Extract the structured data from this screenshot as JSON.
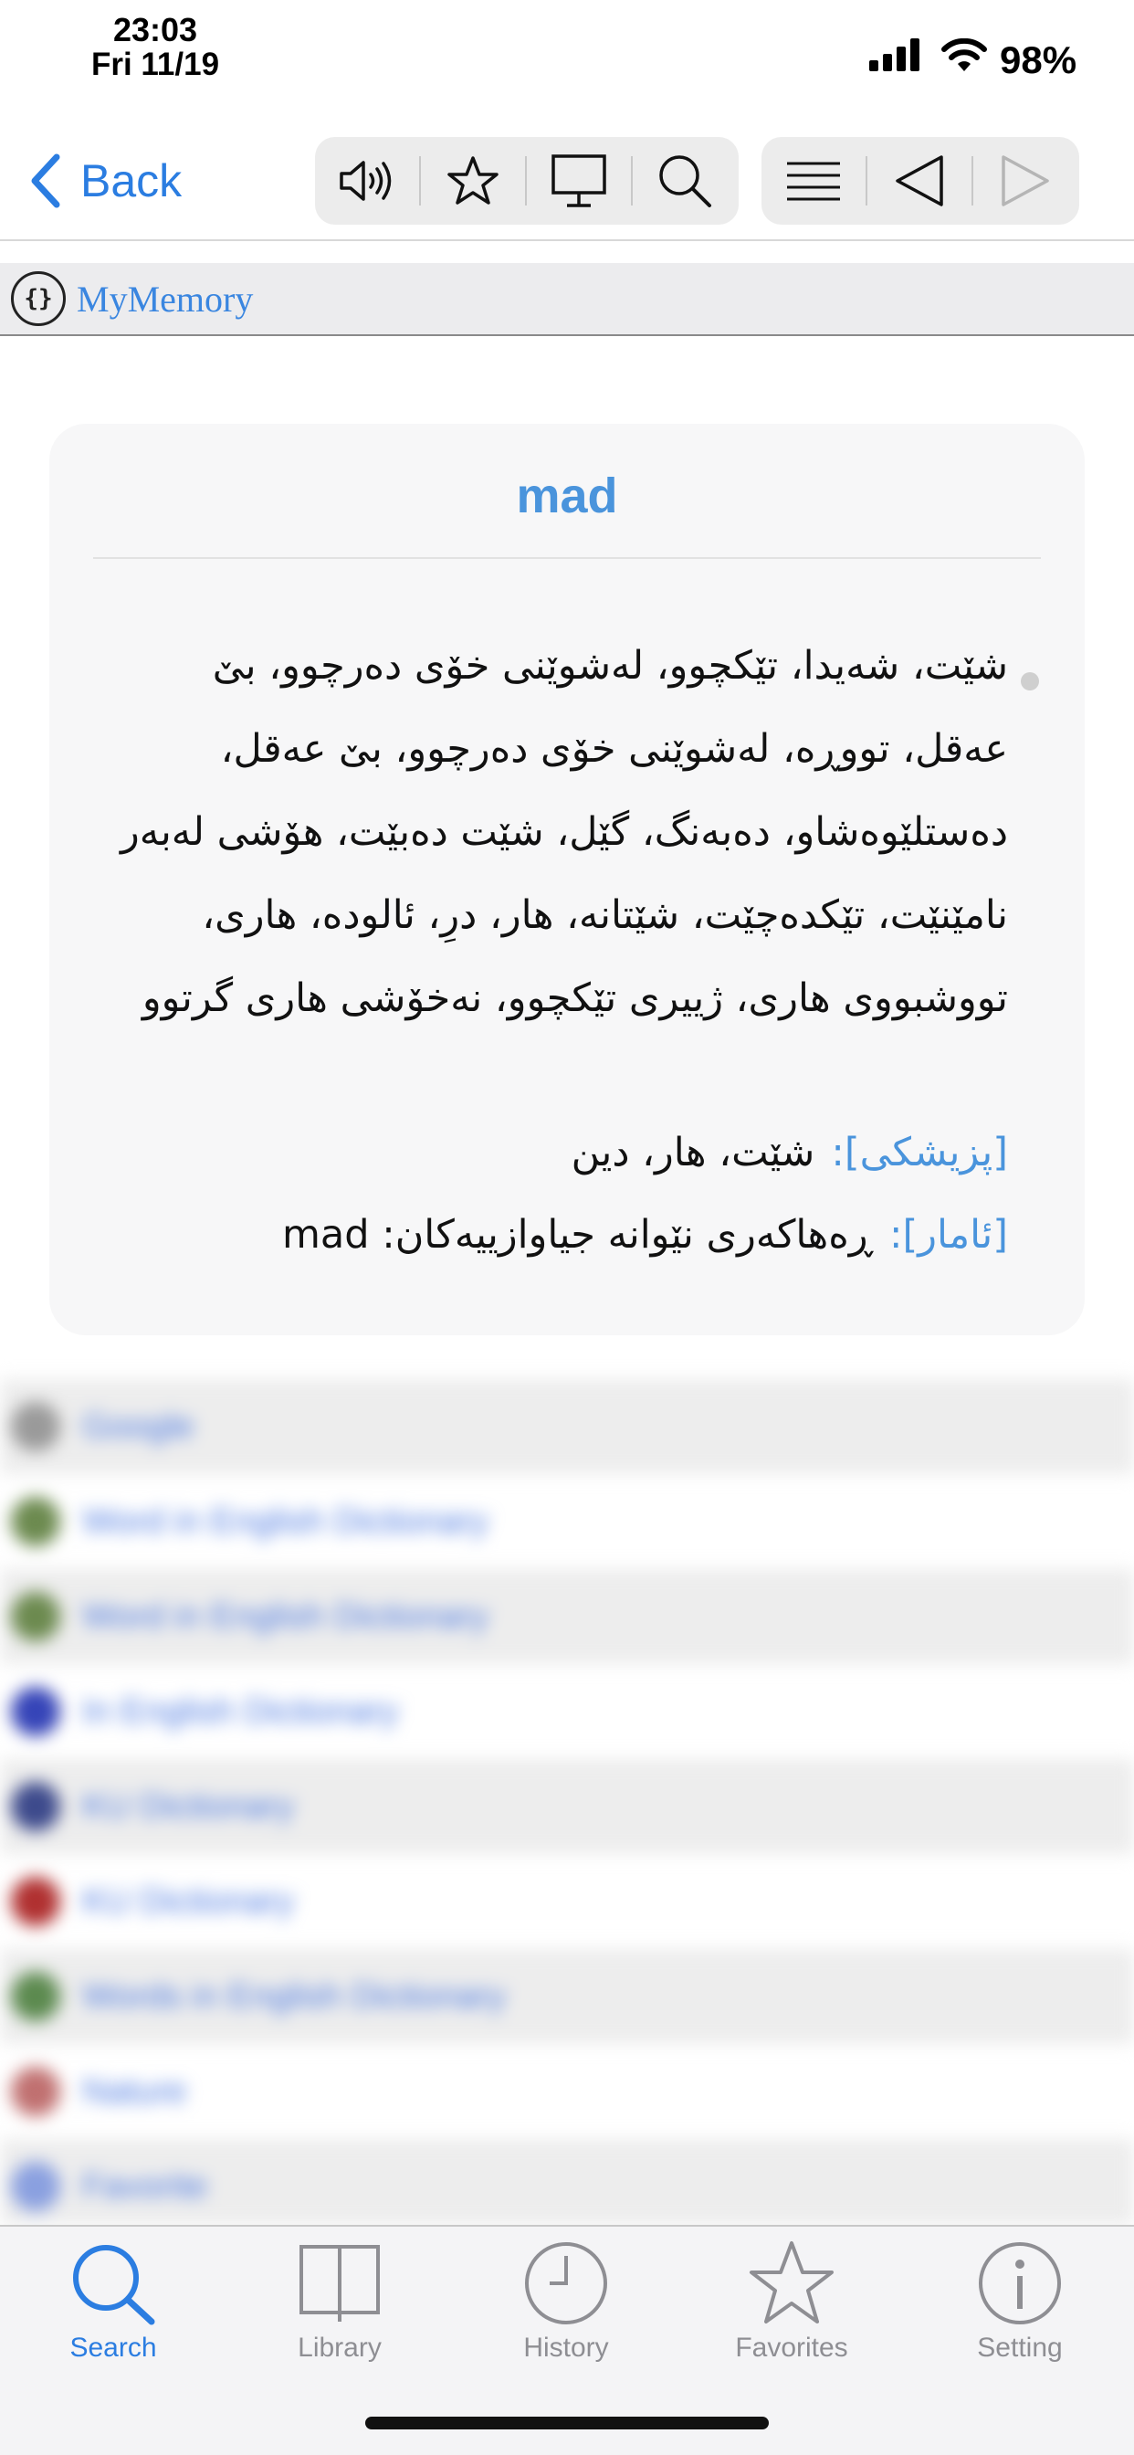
{
  "status_bar": {
    "time": "23:03",
    "date": "Fri 11/19",
    "battery": "98%",
    "icons": [
      "signal-icon",
      "wifi-icon"
    ]
  },
  "nav": {
    "back_label": "Back",
    "tools_left": [
      "speaker-icon",
      "star-icon",
      "monitor-icon",
      "search-icon"
    ],
    "tools_right": [
      "list-icon",
      "previous-icon",
      "next-icon"
    ]
  },
  "source": {
    "logo_text": "{}",
    "name": "MyMemory"
  },
  "entry": {
    "headword": "mad",
    "definition": "شێت، شەیدا، تێکچوو، لەشوێنی خۆی دەرچوو، بێ عەقل، تووڕە، لەشوێنی خۆی دەرچوو، بێ عەقل، دەستلێوەشاو، دەبەنگ، گێل، شێت دەبێت، هۆشی لەبەر نامێنێت، تێکدەچێت، شێتانە، هار، درِ، ئالودە، هاری، تووشبووی هاری، ژییری تێکچوو، نەخۆشی هاری گرتوو",
    "medical_tag": "[پزیشکی]:",
    "medical_text": "شێت، هار، دین",
    "stats_tag": "[ئامار]:",
    "stats_text": "ڕەهاکەری نێوانە جیاوازییەکان: mad"
  },
  "blurred_list": {
    "items": [
      "Google",
      "Word in English Dictionary",
      "Word in English Dictionary",
      "In English Dictionary",
      "KU Dictionary",
      "KU Dictionary",
      "Words in English Dictionary",
      "Nature",
      "Favorite"
    ],
    "icon_colors": [
      "#9a9a9a",
      "#6c8a4f",
      "#6c8a4f",
      "#3544b8",
      "#3d4a8c",
      "#b03030",
      "#5c8a4f",
      "#c07070",
      "#8aa0e0"
    ]
  },
  "tabs": [
    {
      "label": "Search",
      "icon": "search-icon",
      "active": true
    },
    {
      "label": "Library",
      "icon": "book-icon",
      "active": false
    },
    {
      "label": "History",
      "icon": "clock-icon",
      "active": false
    },
    {
      "label": "Favorites",
      "icon": "star-icon",
      "active": false
    },
    {
      "label": "Setting",
      "icon": "info-icon",
      "active": false
    }
  ],
  "colors": {
    "accent": "#2b7de1",
    "headword": "#4a94dc",
    "tab_inactive": "#8e8e93"
  }
}
